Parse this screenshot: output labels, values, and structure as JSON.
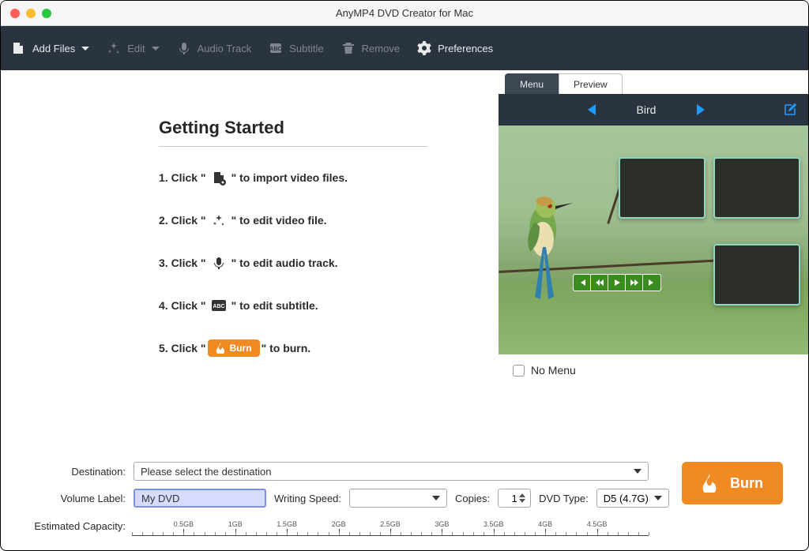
{
  "title": "AnyMP4 DVD Creator for Mac",
  "toolbar": {
    "addFiles": "Add Files",
    "edit": "Edit",
    "audioTrack": "Audio Track",
    "subtitle": "Subtitle",
    "remove": "Remove",
    "preferences": "Preferences"
  },
  "gettingStarted": {
    "heading": "Getting Started",
    "steps": [
      {
        "pre": "1. Click \"",
        "post": "\" to import video files."
      },
      {
        "pre": "2. Click \"",
        "post": "\" to edit video file."
      },
      {
        "pre": "3. Click \"",
        "post": "\" to edit audio track."
      },
      {
        "pre": "4. Click \"",
        "post": "\" to edit subtitle."
      },
      {
        "pre": "5. Click \"",
        "burnLabel": "Burn",
        "post": "\" to burn."
      }
    ]
  },
  "tabs": {
    "menu": "Menu",
    "preview": "Preview"
  },
  "menu": {
    "title": "Bird"
  },
  "noMenu": "No Menu",
  "bottom": {
    "destinationLabel": "Destination:",
    "destinationPlaceholder": "Please select the destination",
    "volumeLabel": "Volume Label:",
    "volumeValue": "My DVD",
    "writingSpeedLabel": "Writing Speed:",
    "copiesLabel": "Copies:",
    "copiesValue": "1",
    "dvdTypeLabel": "DVD Type:",
    "dvdTypeValue": "D5 (4.7G)",
    "estimatedCapacityLabel": "Estimated Capacity:",
    "ticks": [
      "0.5GB",
      "1GB",
      "1.5GB",
      "2GB",
      "2.5GB",
      "3GB",
      "3.5GB",
      "4GB",
      "4.5GB"
    ]
  },
  "burn": "Burn"
}
